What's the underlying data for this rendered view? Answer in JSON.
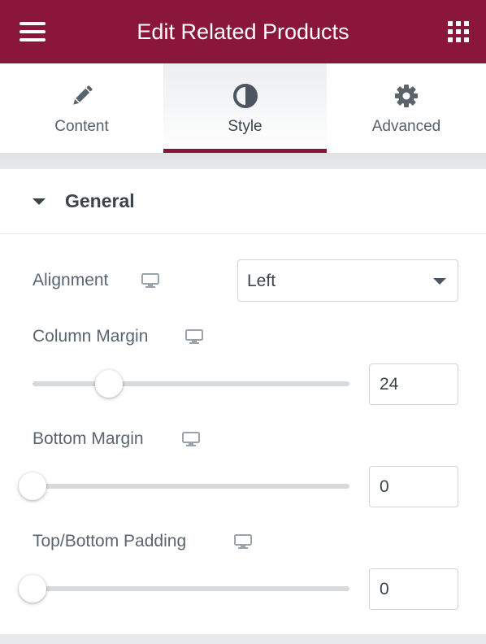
{
  "header": {
    "title": "Edit Related Products",
    "menu_icon": "hamburger-icon",
    "apps_icon": "grid-icon",
    "color": "#8a173b"
  },
  "tabs": [
    {
      "label": "Content",
      "icon": "pencil-icon",
      "active": false
    },
    {
      "label": "Style",
      "icon": "half-circle-icon",
      "active": true
    },
    {
      "label": "Advanced",
      "icon": "gear-icon",
      "active": false
    }
  ],
  "section": {
    "title": "General",
    "expanded": true,
    "controls": {
      "alignment": {
        "label": "Alignment",
        "value": "Left",
        "device_icon": "desktop-icon"
      },
      "column_margin": {
        "label": "Column Margin",
        "value": "24",
        "device_icon": "desktop-icon"
      },
      "bottom_margin": {
        "label": "Bottom Margin",
        "value": "0",
        "device_icon": "desktop-icon"
      },
      "top_bottom_padding": {
        "label": "Top/Bottom Padding",
        "value": "0",
        "device_icon": "desktop-icon"
      }
    }
  }
}
